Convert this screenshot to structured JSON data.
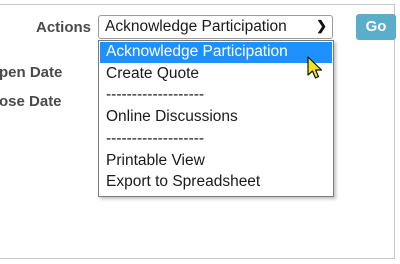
{
  "labels": {
    "actions": "Actions",
    "open_date": "pen Date",
    "close_date": "ose Date"
  },
  "select": {
    "value": "Acknowledge Participation"
  },
  "go_button": "Go",
  "options": [
    "Acknowledge Participation",
    "Create Quote",
    "-------------------",
    "Online Discussions",
    "-------------------",
    "Printable View",
    "Export to Spreadsheet"
  ],
  "selected_option": "Acknowledge Participation",
  "colors": {
    "go_button": "#5aaec9",
    "highlight": "#1e90ff",
    "cursor": "#f5e31a"
  }
}
